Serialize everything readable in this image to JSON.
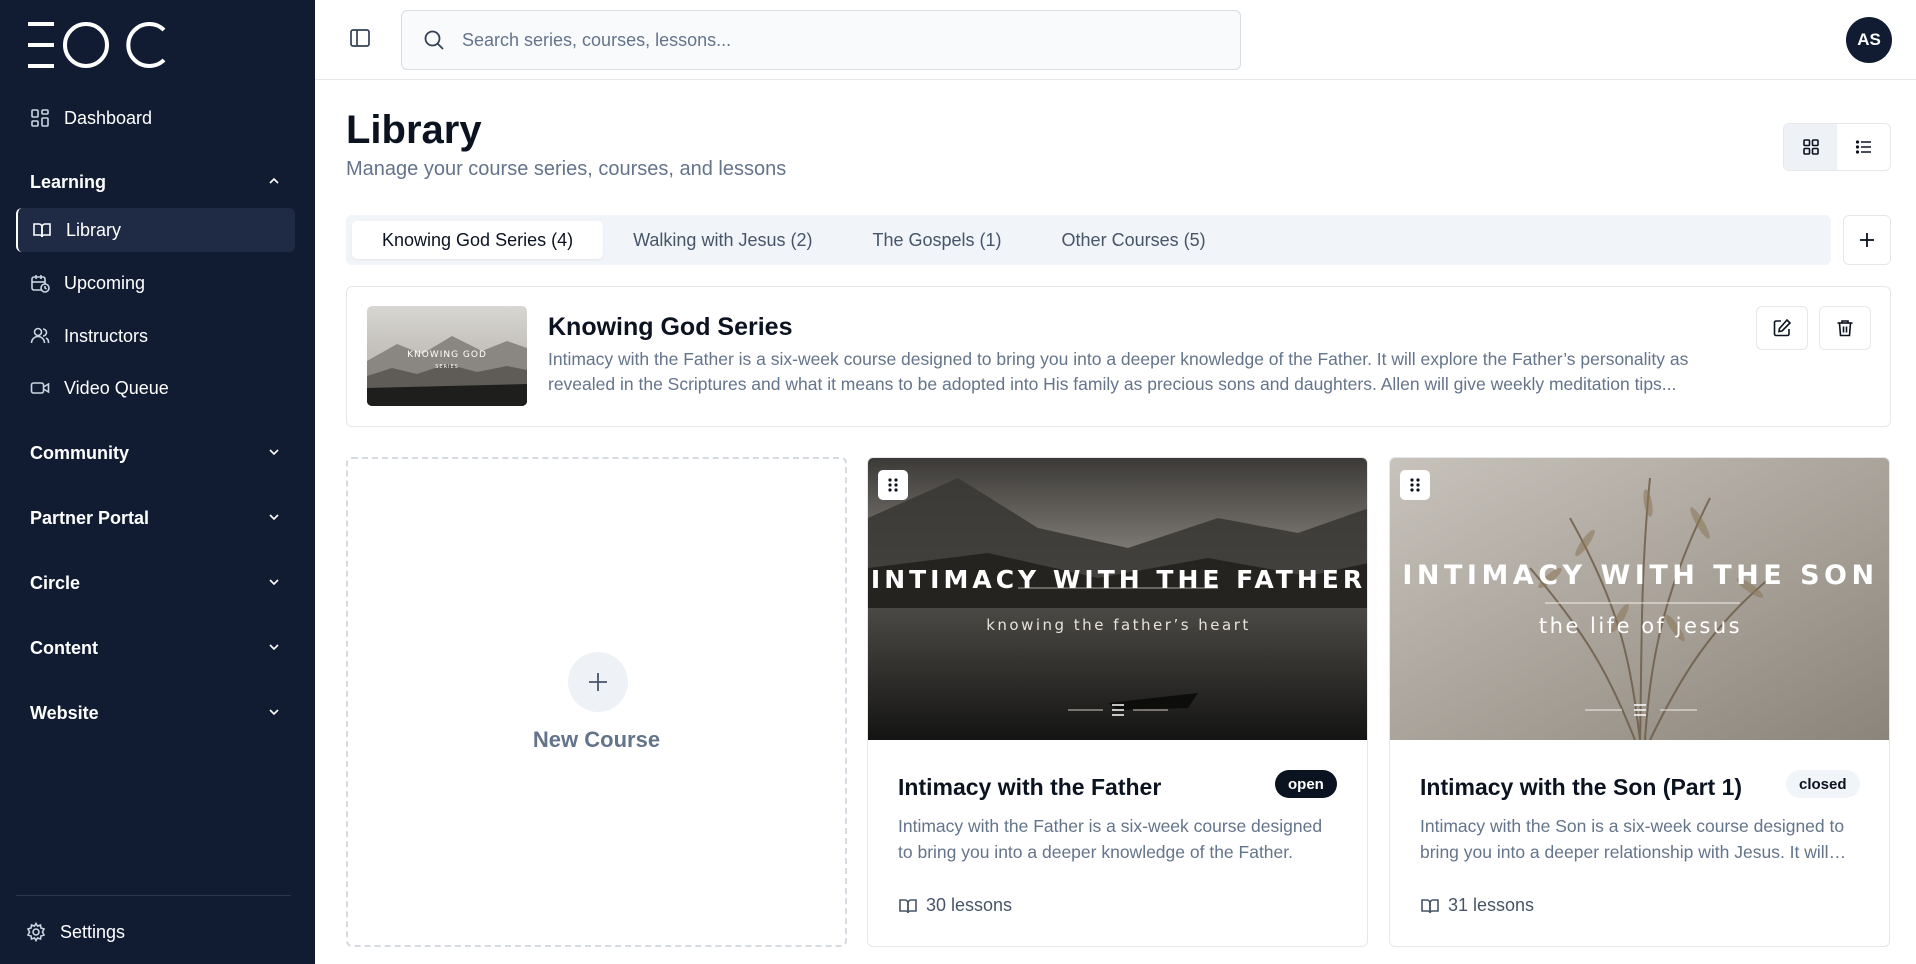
{
  "app": {
    "logo_text": "EOC"
  },
  "sidebar": {
    "dashboard": "Dashboard",
    "learning": {
      "label": "Learning",
      "items": [
        {
          "label": "Library",
          "icon": "book-open-icon"
        },
        {
          "label": "Upcoming",
          "icon": "calendar-clock-icon"
        },
        {
          "label": "Instructors",
          "icon": "users-icon"
        },
        {
          "label": "Video Queue",
          "icon": "video-icon"
        }
      ]
    },
    "groups": [
      "Community",
      "Partner Portal",
      "Circle",
      "Content",
      "Website"
    ],
    "settings": "Settings"
  },
  "topbar": {
    "search_placeholder": "Search series, courses, lessons...",
    "avatar_initials": "AS"
  },
  "page": {
    "title": "Library",
    "subtitle": "Manage your course series, courses, and lessons"
  },
  "tabs": [
    {
      "label": "Knowing God Series (4)",
      "active": true
    },
    {
      "label": "Walking with Jesus (2)",
      "active": false
    },
    {
      "label": "The Gospels (1)",
      "active": false
    },
    {
      "label": "Other Courses (5)",
      "active": false
    }
  ],
  "series": {
    "name": "Knowing God Series",
    "description": "Intimacy with the Father is a six-week course designed to bring you into a deeper knowledge of the Father. It will explore the Father’s personality as revealed in the Scriptures and what it means to be adopted into His family as precious sons and daughters. Allen will give weekly meditation tips...",
    "thumb_title": "KNOWING GOD",
    "thumb_subtitle": "SERIES"
  },
  "new_course_label": "New Course",
  "courses": [
    {
      "title": "Intimacy with the Father",
      "status": "open",
      "description": "Intimacy with the Father is a six-week course designed to bring you into a deeper knowledge of the Father.",
      "lessons": "30 lessons",
      "cover_title": "INTIMACY WITH THE FATHER",
      "cover_subtitle": "knowing the father’s heart"
    },
    {
      "title": "Intimacy with the Son (Part 1)",
      "status": "closed",
      "description": "Intimacy with the Son is a six-week course designed to bring you into a deeper relationship with Jesus. It will explore",
      "lessons": "31 lessons",
      "cover_title": "INTIMACY WITH THE SON",
      "cover_subtitle": "the life of jesus"
    }
  ],
  "colors": {
    "sidebar_bg": "#111c33",
    "accent_dark": "#0b1220",
    "muted": "#64748b"
  }
}
